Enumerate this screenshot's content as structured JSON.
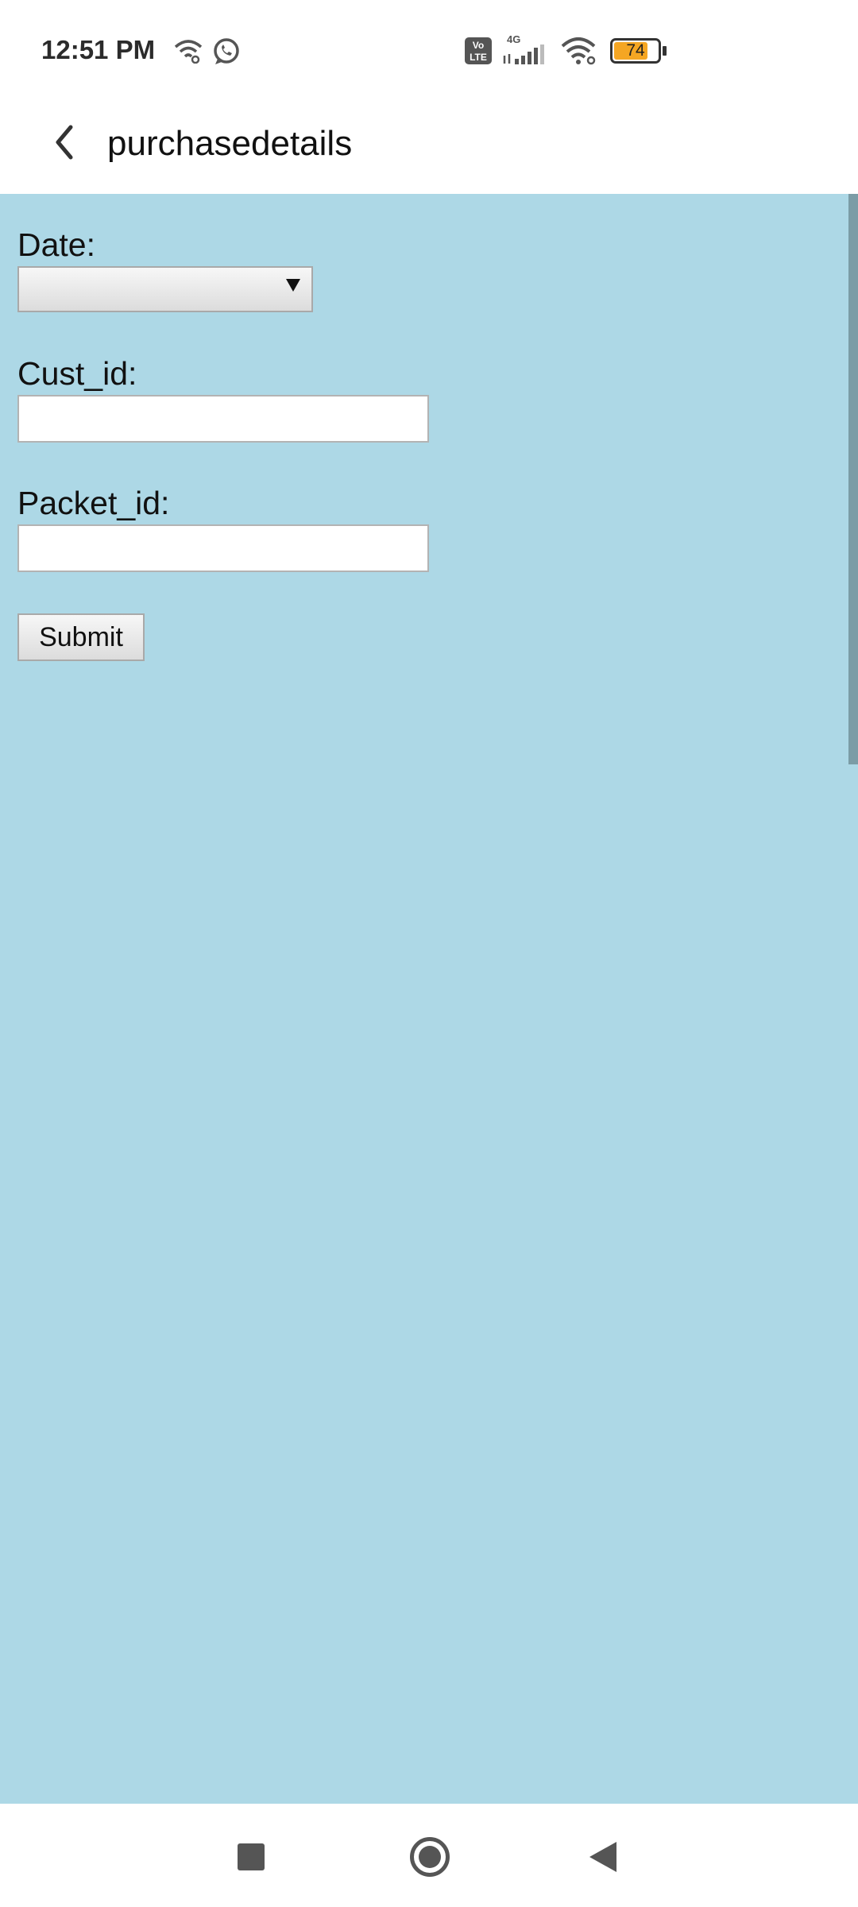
{
  "status_bar": {
    "time": "12:51 PM",
    "icons": [
      "wifi-hotspot-icon",
      "whatsapp-icon",
      "volte-icon",
      "4g-signal-icon",
      "wifi-icon"
    ],
    "network_label": "4G",
    "volte_label": "Vo LTE",
    "battery_percent": "74",
    "battery_color": "#f5a623"
  },
  "app_bar": {
    "title": "purchasedetails",
    "back_icon": "chevron-left-icon"
  },
  "form": {
    "background_color": "#add8e6",
    "date_label": "Date:",
    "date_value": "",
    "cust_id_label": "Cust_id:",
    "cust_id_value": "",
    "packet_id_label": "Packet_id:",
    "packet_id_value": "",
    "submit_label": "Submit"
  },
  "nav_bar": {
    "icons": [
      "recents-square-icon",
      "home-circle-icon",
      "back-triangle-icon"
    ]
  }
}
